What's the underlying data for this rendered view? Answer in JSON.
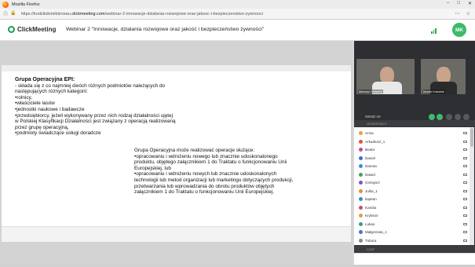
{
  "browser": {
    "title": "Mozilla Firefox",
    "url_prefix": "https://kodzikdomiblzneau.",
    "url_domain": "clickmeeting.com",
    "url_path": "/webinar-2-innowacje-dzialania-rozwojowe-oraz-jakosc-i-bezpieczenstwo-zywnosci"
  },
  "header": {
    "logo_text": "ClickMeeting",
    "webinar_title": "Webinar 2 \"Innowacje, dzialania rozwojowe oraz jakość i bezpieczeństwo żywności\"",
    "avatar_initials": "MK"
  },
  "slide": {
    "heading": "Grupa Operacyjna EPI:",
    "block_a_lines": [
      "- składa się z co najmniej dwóch różnych podmiotów należących do",
      "następujących różnych kategorii:",
      "•rolnicy,",
      "•właściciele lasów",
      "•jednostki naukowe i badawcze",
      "•przedsiębiorcy, jeżeli wykonywany przez nich rodzaj działalności ujętej",
      "w Polskiej Klasyfikacji Działalności jest związany z operacją realizowaną",
      "przez grupę operacyjną,",
      "•podmioty świadczące usługi doradcze"
    ],
    "block_b_lines": [
      "Grupa Operacyjna może realizować operacje służące:",
      "•opracowaniu i wdrożeniu nowego lub znacznie udoskonalonego",
      "produktu, objętego załącznikiem 1 do Traktatu o funkcjonowaniu Unii",
      "Europejskiej, lub",
      "•opracowaniu i wdrożeniu nowych lub znacznie udoskonalonych",
      "technologii lub metod organizacji lub marketingu dotyczących produkcji,",
      "przetwarzania lub wprowadzania do obrotu produktów objętych",
      "załącznikiem 1 do Traktatu o funkcjonowaniu Unii Europejskiej."
    ]
  },
  "presenters": [
    {
      "name": "Mariusz Szkarek"
    },
    {
      "name": "Marek Kokotek"
    }
  ],
  "panel": {
    "on_air_label": "OKNO AV",
    "attendees_label": "UCZESTNICY",
    "chat_label": "CZAT"
  },
  "attendees": [
    {
      "name": "Anna",
      "color": "#e9a23b"
    },
    {
      "name": "Arkadiusz_1",
      "color": "#e0533d"
    },
    {
      "name": "Beata",
      "color": "#c04e8f"
    },
    {
      "name": "Daniel",
      "color": "#3b6fd1"
    },
    {
      "name": "Danuta",
      "color": "#3c8dd8"
    },
    {
      "name": "Dawid",
      "color": "#4d9b6a"
    },
    {
      "name": "Grzegorz",
      "color": "#7c56c7"
    },
    {
      "name": "Julita_1",
      "color": "#e2913a"
    },
    {
      "name": "kajetan",
      "color": "#3a88c8"
    },
    {
      "name": "Kamila",
      "color": "#d04a6b"
    },
    {
      "name": "Krykson",
      "color": "#e0a13a"
    },
    {
      "name": "Lukas",
      "color": "#3b9b8a"
    },
    {
      "name": "Małgorzata_1",
      "color": "#4a6fd0"
    },
    {
      "name": "Tubora",
      "color": "#8a8a8a"
    }
  ],
  "colors": {
    "accent": "#3fb96c",
    "panel_dark": "#2d2f33"
  }
}
